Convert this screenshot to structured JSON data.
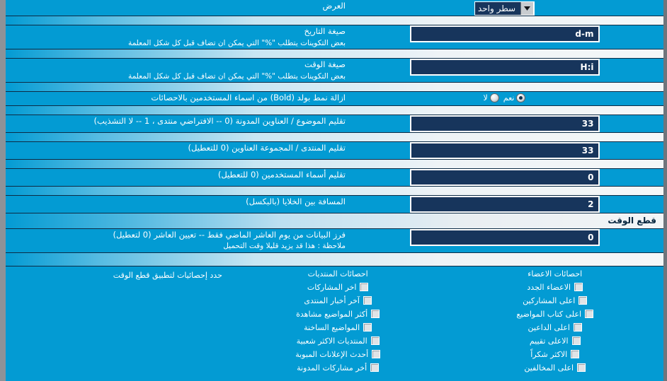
{
  "page": {
    "direction": "rtl",
    "background_color": "#039bd3",
    "input_background": "#17355c",
    "accent_border": "#ffffff"
  },
  "rows": {
    "display": {
      "label": "العرض",
      "desc": "",
      "control": "select",
      "value": "سطر واحد"
    },
    "date_format": {
      "label": "صيغة التاريخ",
      "desc": "بعض التكوينات يتطلب \"%\" التي يمكن ان تضاف قبل كل شكل المعلمة",
      "control": "text",
      "value": "d-m"
    },
    "time_format": {
      "label": "صيغة الوقت",
      "desc": "بعض التكوينات يتطلب \"%\" التي يمكن ان تضاف قبل كل شكل المعلمة",
      "control": "text",
      "value": "H:i"
    },
    "remove_bold": {
      "label": "ازالة نمط بولد (Bold) من اسماء المستخدمين بالاحصائات",
      "desc": "",
      "control": "radio",
      "options": [
        {
          "label": "نعم",
          "checked": true
        },
        {
          "label": "لا",
          "checked": false
        }
      ]
    },
    "trim_title": {
      "label": "تقليم الموضوع / العناوين المدونة (0 -- الافتراضي منتدى ، 1 -- لا التشذيب)",
      "desc": "",
      "control": "text",
      "value": "33"
    },
    "trim_forum": {
      "label": "تقليم المنتدى / المجموعة العناوين (0 للتعطيل)",
      "desc": "",
      "control": "text",
      "value": "33"
    },
    "trim_username": {
      "label": "تقليم أسماء المستخدمين (0 للتعطيل)",
      "desc": "",
      "control": "text",
      "value": "0"
    },
    "cell_spacing": {
      "label": "المسافة بين الخلايا (بالبكسل)",
      "desc": "",
      "control": "text",
      "value": "2"
    },
    "cutoff_days": {
      "label": "فرز البيانات من يوم العاشر الماضي فقط -- تعيين العاشر (0 لتعطيل)",
      "desc": "ملاحظة : هذا قد يزيد قليلا وقت التحميل",
      "control": "text",
      "value": "0"
    }
  },
  "section_header": {
    "title": "قطع الوقت"
  },
  "checkbox_section": {
    "right_label": "حدد إحصائيات لتطبيق قطع الوقت",
    "columns": [
      {
        "head": "احصائات الاعضاء",
        "items": [
          {
            "label": "الاعضاء الجدد",
            "checked": false
          },
          {
            "label": "اعلى المشاركين",
            "checked": false
          },
          {
            "label": "اعلى كتاب المواضيع",
            "checked": false
          },
          {
            "label": "اعلى الداعين",
            "checked": false
          },
          {
            "label": "الاعلى تقييم",
            "checked": false
          },
          {
            "label": "الاكثر شكراً",
            "checked": false
          },
          {
            "label": "اعلى المخالفين",
            "checked": false
          }
        ]
      },
      {
        "head": "احصائات المنتديات",
        "items": [
          {
            "label": "اخر المشاركات",
            "checked": false
          },
          {
            "label": "آخر أخبار المنتدى",
            "checked": false
          },
          {
            "label": "أكثر المواضيع مشاهدة",
            "checked": false
          },
          {
            "label": "المواضيع الساخنة",
            "checked": false
          },
          {
            "label": "المنتديات الاكثر شعبية",
            "checked": false
          },
          {
            "label": "أحدث الإعلانات المبوبة",
            "checked": false
          },
          {
            "label": "أخر مشاركات المدونة",
            "checked": false
          }
        ]
      }
    ]
  },
  "icons": {
    "select_arrow": "chevron-down-icon"
  }
}
